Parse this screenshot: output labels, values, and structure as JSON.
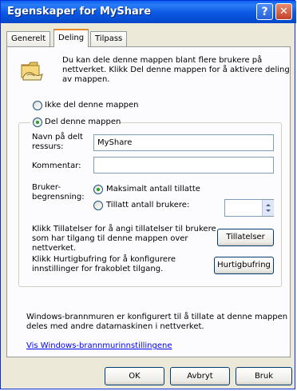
{
  "window": {
    "title": "Egenskaper for MyShare",
    "help_glyph": "?",
    "close_glyph": "✕"
  },
  "tabs": [
    {
      "label": "Generelt",
      "active": false
    },
    {
      "label": "Deling",
      "active": true
    },
    {
      "label": "Tilpass",
      "active": false
    }
  ],
  "intro": {
    "lines": [
      "Du kan dele denne mappen blant flere brukere på",
      "nettverket. Klikk Del denne mappen for å aktivere deling",
      "av mappen."
    ],
    "icon": "shared-folder-icon"
  },
  "sharing": {
    "do_not_share_label": "Ikke del denne mappen",
    "do_not_share_selected": false,
    "share_label": "Del denne mappen",
    "share_selected": true
  },
  "share_name": {
    "label_lines": [
      "Navn på delt",
      "ressurs:"
    ],
    "value": "MyShare"
  },
  "comment": {
    "label": "Kommentar:",
    "value": ""
  },
  "user_limit": {
    "label_lines": [
      "Bruker-",
      "begrensning:"
    ],
    "max_allowed_label": "Maksimalt antall tillatte",
    "max_allowed_selected": true,
    "allow_users_label": "Tillatt antall brukere:",
    "allow_users_selected": false,
    "allow_users_value": ""
  },
  "permissions": {
    "text_lines": [
      "Klikk Tillatelser for å angi tillatelser til brukere",
      "som har tilgang til denne mappen over",
      "nettverket."
    ],
    "button_label": "Tillatelser"
  },
  "caching": {
    "text_lines": [
      "Klikk Hurtigbufring for å konfigurere",
      "innstillinger for frakoblet tilgang."
    ],
    "button_label": "Hurtigbufring"
  },
  "firewall": {
    "text_lines": [
      "Windows-brannmuren er konfigurert til å tillate at denne mappen",
      "deles med andre datamaskinen i nettverket."
    ],
    "link_label": "Vis Windows-brannmurinnstillingene"
  },
  "footer": {
    "ok_label": "OK",
    "cancel_label": "Avbryt",
    "apply_label": "Bruk"
  }
}
